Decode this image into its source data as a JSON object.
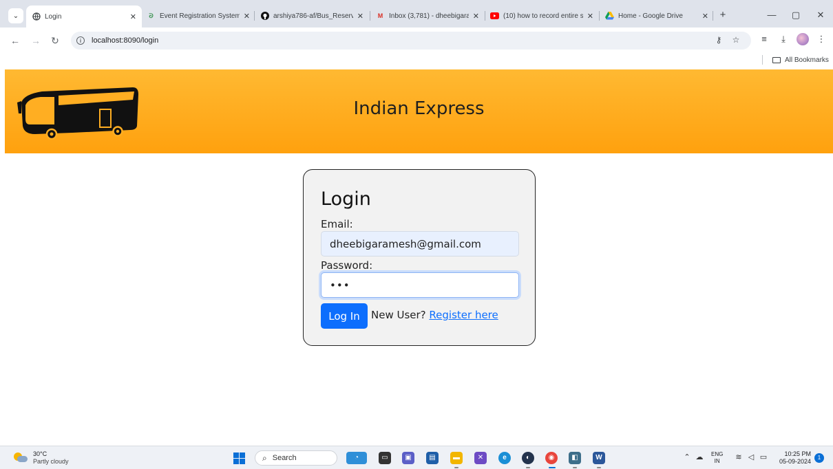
{
  "browser": {
    "tabs": [
      {
        "title": "Login",
        "favicon": "globe-icon",
        "active": true
      },
      {
        "title": "Event Registration System",
        "favicon": "gfg-icon",
        "active": false
      },
      {
        "title": "arshiya786-af/Bus_Reserva",
        "favicon": "github-icon",
        "active": false
      },
      {
        "title": "Inbox (3,781) - dheebigara",
        "favicon": "gmail-icon",
        "active": false
      },
      {
        "title": "(10) how to record entire s",
        "favicon": "youtube-icon",
        "active": false
      },
      {
        "title": "Home - Google Drive",
        "favicon": "drive-icon",
        "active": false
      }
    ],
    "url": "localhost:8090/login",
    "bookmarks_all_label": "All Bookmarks"
  },
  "site": {
    "title": "Indian Express",
    "logo": "bus-logo",
    "header_color": "#ffa10e"
  },
  "login": {
    "heading": "Login",
    "email_label": "Email:",
    "email_value": "dheebigaramesh@gmail.com",
    "password_label": "Password:",
    "password_masked": "•••",
    "submit_label": "Log In",
    "new_user_text": "New User?",
    "register_link": "Register here",
    "accent_color": "#0d6efd"
  },
  "taskbar": {
    "weather_temp": "30°C",
    "weather_desc": "Partly cloudy",
    "search_placeholder": "Search",
    "lang_line1": "ENG",
    "lang_line2": "IN",
    "time": "10:25 PM",
    "date": "05-09-2024",
    "notification_count": "1"
  }
}
